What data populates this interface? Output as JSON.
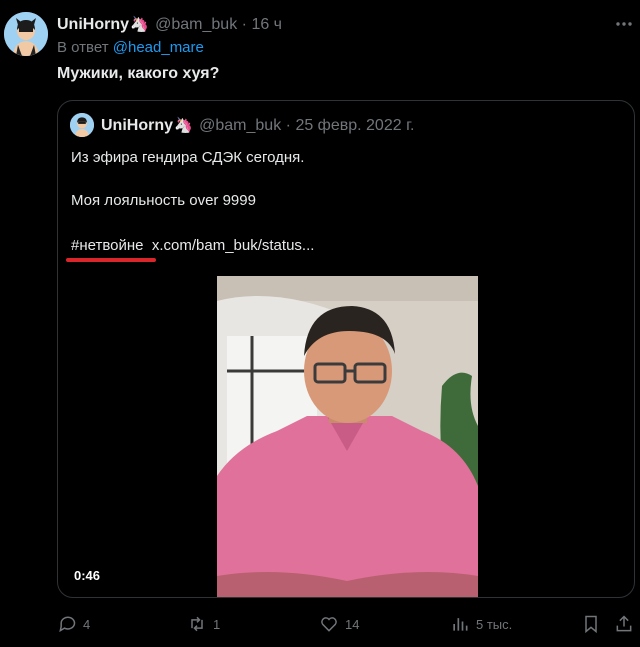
{
  "post": {
    "display_name": "UniHorny",
    "handle": "@bam_buk",
    "separator": "·",
    "time": "16 ч",
    "reply_prefix": "В ответ",
    "reply_to": "@head_mare",
    "text": "Мужики, какого хуя?"
  },
  "quote": {
    "display_name": "UniHorny",
    "handle": "@bam_buk",
    "separator": "·",
    "date": "25 февр. 2022 г.",
    "line1": "Из эфира гендира СДЭК сегодня.",
    "line2": "Моя лояльность over 9999",
    "hashtag": "#нетвойне",
    "link": "x.com/bam_buk/status...",
    "video_duration": "0:46"
  },
  "actions": {
    "replies": "4",
    "reposts": "1",
    "likes": "14",
    "views": "5 тыс."
  },
  "colors": {
    "background": "#000000",
    "text": "#e7e9ea",
    "muted": "#71767b",
    "link": "#1d9bf0",
    "border": "#2f3336",
    "annotation": "#d9262a"
  },
  "icons": [
    "avatar",
    "unicorn-emoji",
    "more-icon",
    "reply-icon",
    "repost-icon",
    "like-icon",
    "views-icon",
    "bookmark-icon",
    "share-icon"
  ]
}
